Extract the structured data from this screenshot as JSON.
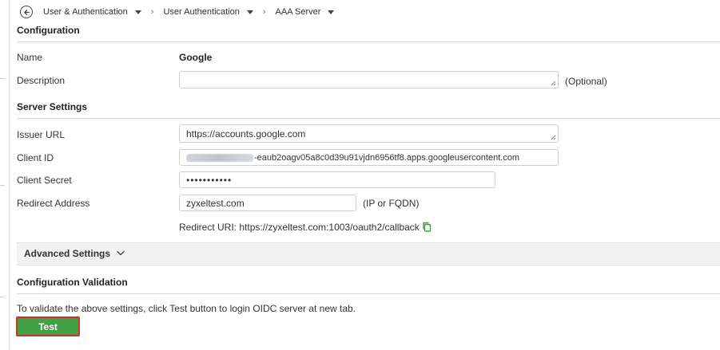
{
  "breadcrumb": {
    "items": [
      {
        "label": "User & Authentication"
      },
      {
        "label": "User Authentication"
      },
      {
        "label": "AAA Server"
      }
    ]
  },
  "configuration": {
    "title": "Configuration",
    "name_label": "Name",
    "name_value": "Google",
    "description_label": "Description",
    "description_value": "",
    "description_hint": "(Optional)"
  },
  "server_settings": {
    "title": "Server Settings",
    "issuer_url_label": "Issuer URL",
    "issuer_url_value": "https://accounts.google.com",
    "client_id_label": "Client ID",
    "client_id_value_visible": "-eaub2oagv05a8c0d39u91vjdn6956tf8.apps.googleusercontent.com",
    "client_secret_label": "Client Secret",
    "client_secret_value": "•••••••••••",
    "redirect_address_label": "Redirect Address",
    "redirect_address_value": "zyxeltest.com",
    "redirect_address_hint": "(IP or FQDN)",
    "redirect_uri_text": "Redirect URI: https://zyxeltest.com:1003/oauth2/callback"
  },
  "advanced_settings": {
    "label": "Advanced Settings"
  },
  "validation": {
    "title": "Configuration Validation",
    "instruction": "To validate the above settings, click Test button to login OIDC server at new tab.",
    "test_button_label": "Test"
  },
  "colors": {
    "test_button_bg": "#43a047",
    "test_button_outline": "#c0392b",
    "copy_icon": "#3aa33a"
  }
}
